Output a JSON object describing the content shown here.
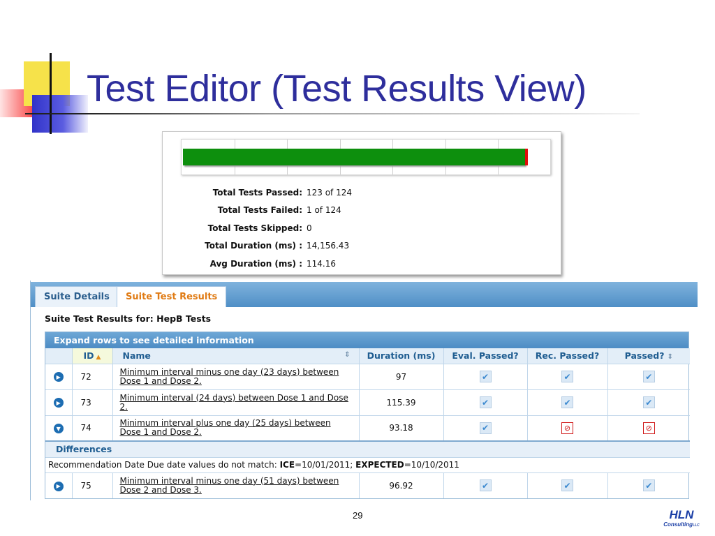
{
  "slide": {
    "title": "Test Editor (Test Results View)",
    "page_number": "29",
    "logo": {
      "main": "HLN",
      "sub": "Consulting",
      "sub_suffix": "LLC"
    }
  },
  "summary": {
    "progress": {
      "passed": 123,
      "total": 124,
      "pass_color": "#0d8f0d",
      "fail_color": "#e00d0d"
    },
    "stats": [
      {
        "label": "Total Tests Passed:",
        "value": "123 of 124"
      },
      {
        "label": "Total Tests Failed:",
        "value": "1 of 124"
      },
      {
        "label": "Total Tests Skipped:",
        "value": "0"
      },
      {
        "label": "Total Duration (ms) :",
        "value": "14,156.43"
      },
      {
        "label": "Avg Duration (ms) :",
        "value": "114.16"
      }
    ]
  },
  "tabs": [
    {
      "label": "Suite Details",
      "active": false
    },
    {
      "label": "Suite Test Results",
      "active": true
    }
  ],
  "results": {
    "caption": "Suite Test Results for: HepB Tests",
    "expand_hint": "Expand rows to see detailed information",
    "columns": {
      "id": "ID",
      "name": "Name",
      "duration": "Duration (ms)",
      "eval_passed": "Eval. Passed?",
      "rec_passed": "Rec. Passed?",
      "passed": "Passed?"
    },
    "rows": [
      {
        "id": "72",
        "name": "Minimum interval minus one day (23 days) between Dose 1 and Dose 2.",
        "duration": "97",
        "eval": "pass",
        "rec": "pass",
        "passed": "pass",
        "expanded": false
      },
      {
        "id": "73",
        "name": "Minimum interval (24 days) between Dose 1 and Dose 2.",
        "duration": "115.39",
        "eval": "pass",
        "rec": "pass",
        "passed": "pass",
        "expanded": false
      },
      {
        "id": "74",
        "name": "Minimum interval plus one day (25 days) between Dose 1 and Dose 2.",
        "duration": "93.18",
        "eval": "pass",
        "rec": "fail",
        "passed": "fail",
        "expanded": true
      },
      {
        "id": "75",
        "name": "Minimum interval minus one day (51 days) between Dose 2 and Dose 3.",
        "duration": "96.92",
        "eval": "pass",
        "rec": "pass",
        "passed": "pass",
        "expanded": false
      }
    ],
    "differences": {
      "heading": "Differences",
      "prefix": "Recommendation Date Due date values do not match: ",
      "ice_label": "ICE",
      "ice_value": "=10/01/2011; ",
      "expected_label": "EXPECTED",
      "expected_value": "=10/10/2011"
    }
  },
  "icons": {
    "expand": "expand-arrow-icon",
    "collapse": "collapse-arrow-icon",
    "check": "checkmark-icon",
    "fail": "fail-icon",
    "sort_asc": "sort-ascending-icon",
    "sortable": "sortable-icon"
  }
}
